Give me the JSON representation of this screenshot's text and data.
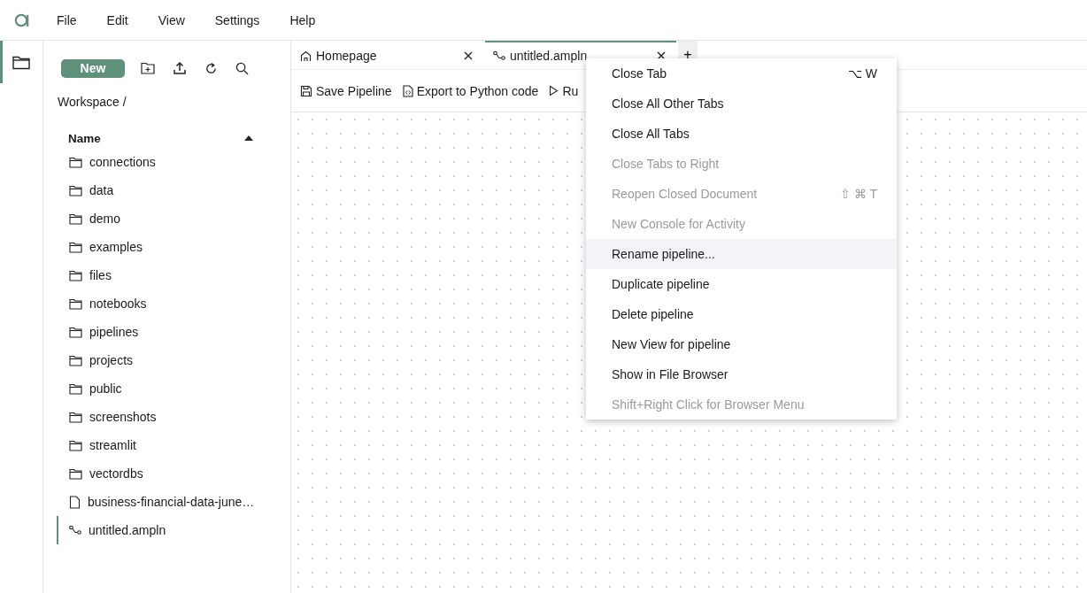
{
  "menubar": {
    "items": [
      "File",
      "Edit",
      "View",
      "Settings",
      "Help"
    ]
  },
  "activity_bar": {
    "items": [
      {
        "kind": "files",
        "selected": true
      }
    ]
  },
  "file_browser": {
    "new_button": "New",
    "breadcrumb": "Workspace /",
    "column": "Name",
    "sort_ascending": true,
    "items": [
      {
        "name": "connections",
        "kind": "folder",
        "selected": false
      },
      {
        "name": "data",
        "kind": "folder",
        "selected": false
      },
      {
        "name": "demo",
        "kind": "folder",
        "selected": false
      },
      {
        "name": "examples",
        "kind": "folder",
        "selected": false
      },
      {
        "name": "files",
        "kind": "folder",
        "selected": false
      },
      {
        "name": "notebooks",
        "kind": "folder",
        "selected": false
      },
      {
        "name": "pipelines",
        "kind": "folder",
        "selected": false
      },
      {
        "name": "projects",
        "kind": "folder",
        "selected": false
      },
      {
        "name": "public",
        "kind": "folder",
        "selected": false
      },
      {
        "name": "screenshots",
        "kind": "folder",
        "selected": false
      },
      {
        "name": "streamlit",
        "kind": "folder",
        "selected": false
      },
      {
        "name": "vectordbs",
        "kind": "folder",
        "selected": false
      },
      {
        "name": "business-financial-data-june…",
        "kind": "file",
        "selected": false
      },
      {
        "name": "untitled.ampln",
        "kind": "pipeline",
        "selected": true
      }
    ]
  },
  "tabs": [
    {
      "label": "Homepage",
      "kind": "home",
      "selected": false
    },
    {
      "label": "untitled.ampln",
      "kind": "pipeline",
      "selected": true
    }
  ],
  "add_tab": "+",
  "toolbar": [
    {
      "label": "Save Pipeline",
      "kind": "save"
    },
    {
      "label": "Export to Python code",
      "kind": "export"
    },
    {
      "label": "Ru",
      "kind": "run"
    }
  ],
  "context_menu": {
    "items": [
      {
        "label": "Close Tab",
        "shortcut": "⌥ W",
        "disabled": false,
        "highlighted": false
      },
      {
        "label": "Close All Other Tabs",
        "disabled": false,
        "highlighted": false
      },
      {
        "label": "Close All Tabs",
        "disabled": false,
        "highlighted": false
      },
      {
        "label": "Close Tabs to Right",
        "disabled": true,
        "highlighted": false
      },
      {
        "label": "Reopen Closed Document",
        "shortcut": "⇧ ⌘ T",
        "disabled": true,
        "highlighted": false
      },
      {
        "label": "New Console for Activity",
        "disabled": true,
        "highlighted": false
      },
      {
        "label": "Rename pipeline...",
        "disabled": false,
        "highlighted": true
      },
      {
        "label": "Duplicate pipeline",
        "disabled": false,
        "highlighted": false
      },
      {
        "label": "Delete pipeline",
        "disabled": false,
        "highlighted": false
      },
      {
        "label": "New View for pipeline",
        "disabled": false,
        "highlighted": false
      },
      {
        "label": "Show in File Browser",
        "disabled": false,
        "highlighted": false
      },
      {
        "label": "Shift+Right Click for Browser Menu",
        "disabled": true,
        "highlighted": false
      }
    ]
  }
}
